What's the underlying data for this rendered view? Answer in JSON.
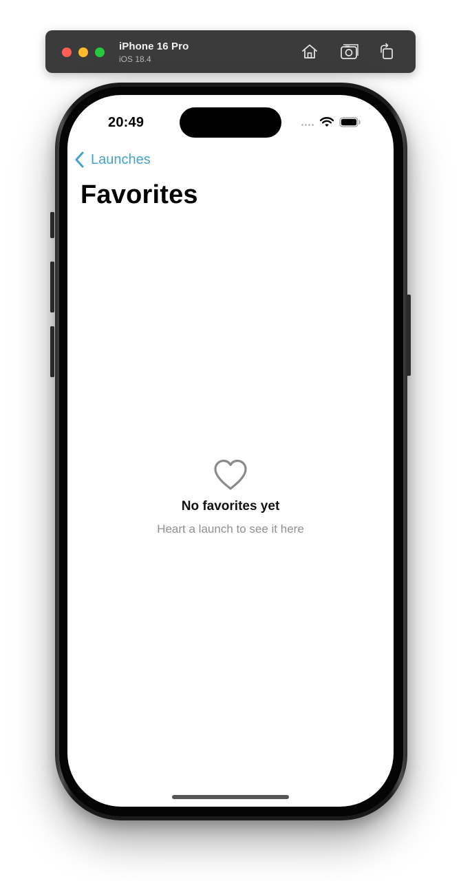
{
  "simulator": {
    "device_name": "iPhone 16 Pro",
    "os_version": "iOS 18.4",
    "icons": [
      "home-icon",
      "screenshot-icon",
      "rotate-icon"
    ]
  },
  "status_bar": {
    "time": "20:49",
    "icons": [
      "cellular-icon",
      "wifi-icon",
      "battery-icon"
    ]
  },
  "nav": {
    "back_label": "Launches",
    "title": "Favorites",
    "accent_color": "#45a3c5"
  },
  "empty_state": {
    "icon": "heart-outline-icon",
    "title": "No favorites yet",
    "subtitle": "Heart a launch to see it here"
  }
}
